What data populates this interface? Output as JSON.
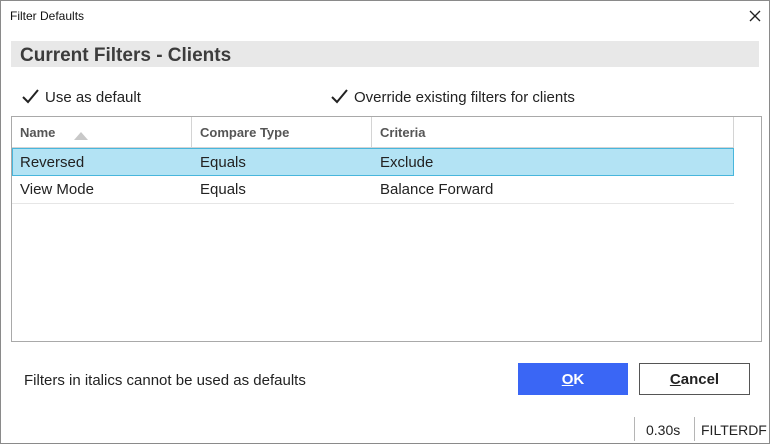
{
  "window": {
    "title": "Filter Defaults",
    "close_icon": "close-icon"
  },
  "header": {
    "title": "Current Filters - Clients"
  },
  "options": {
    "use_as_default": {
      "label": "Use as default",
      "checked": true
    },
    "override_existing": {
      "label": "Override existing filters for clients",
      "checked": true
    }
  },
  "grid": {
    "columns": [
      "Name",
      "Compare Type",
      "Criteria"
    ],
    "sort": {
      "column": "Name",
      "direction": "ascending"
    },
    "rows": [
      {
        "name": "Reversed",
        "compare_type": "Equals",
        "criteria": "Exclude",
        "selected": true
      },
      {
        "name": "View Mode",
        "compare_type": "Equals",
        "criteria": "Balance Forward",
        "selected": false
      }
    ]
  },
  "footer": {
    "note": "Filters in italics cannot be used as defaults",
    "ok_label": "OK",
    "cancel_label": "Cancel"
  },
  "status_bar": {
    "time": "0.30s",
    "code": "FILTERDF"
  },
  "colors": {
    "accent_button": "#3a66f5",
    "selected_row": "#b3e3f4",
    "selected_row_border": "#48b6dc",
    "header_band": "#e8e8e8"
  }
}
